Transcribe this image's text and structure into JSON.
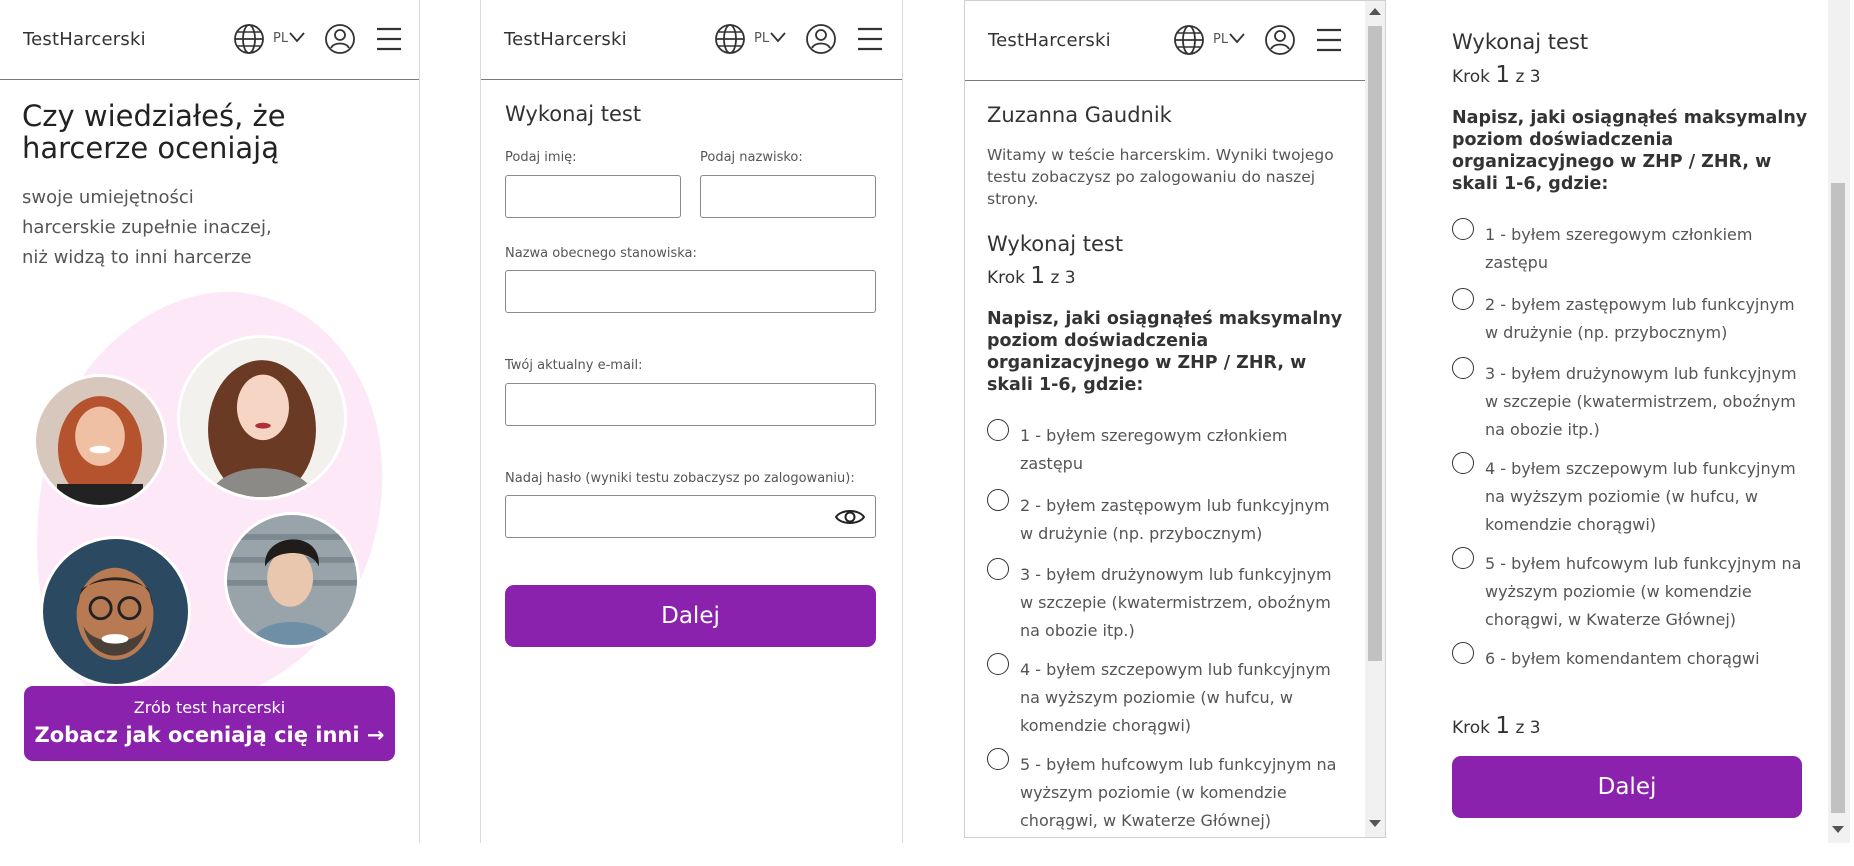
{
  "app": {
    "logo": "TestHarcerski",
    "lang": "PL",
    "accent": "#8b22ae"
  },
  "icons": [
    "globe-icon",
    "chevron-down-icon",
    "user-circle-icon",
    "hamburger-menu-icon",
    "eye-icon",
    "arrow-right-icon"
  ],
  "landing": {
    "title": "Czy wiedziałeś, że harcerze oceniają",
    "subtitle_lines": [
      "swoje umiejętności",
      "harcerskie zupełnie inaczej,",
      "niż widzą to inni harcerze"
    ],
    "cta_small": "Zrób test harcerski",
    "cta_big": "Zobacz jak oceniają cię inni →"
  },
  "form": {
    "title": "Wykonaj test",
    "first_name_label": "Podaj imię:",
    "first_name_value": "",
    "last_name_label": "Podaj nazwisko:",
    "last_name_value": "",
    "position_label": "Nazwa obecnego stanowiska:",
    "position_value": "",
    "email_label": "Twój aktualny e-mail:",
    "email_value": "",
    "password_label": "Nadaj hasło (wyniki testu zobaczysz po zalogowaniu):",
    "password_value": "",
    "next_label": "Dalej"
  },
  "quiz": {
    "user_name": "Zuzanna Gaudnik",
    "intro": "Witamy w teście harcerskim. Wyniki twojego testu zobaczysz po zalogowaniu do naszej strony.",
    "title": "Wykonaj test",
    "step_prefix": "Krok",
    "step_current": "1",
    "step_suffix": "z 3",
    "question": "Napisz, jaki osiągnąłeś maksymalny poziom doświadczenia organizacyjnego w ZHP / ZHR, w skali 1-6, gdzie:",
    "options": [
      "1 - byłem szeregowym członkiem zastępu",
      "2 - byłem zastępowym lub funkcyjnym w drużynie (np. przybocznym)",
      "3 - byłem drużynowym lub funkcyjnym w szczepie (kwatermistrzem, oboźnym na obozie itp.)",
      "4 - byłem szczepowym lub funkcyjnym na wyższym poziomie (w hufcu, w komendzie chorągwi)",
      "5 - byłem hufcowym lub funkcyjnym na wyższym poziomie (w komendzie chorągwi, w Kwaterze Głównej)",
      "6 - byłem komendantem chorągwi"
    ],
    "next_label": "Dalej"
  }
}
